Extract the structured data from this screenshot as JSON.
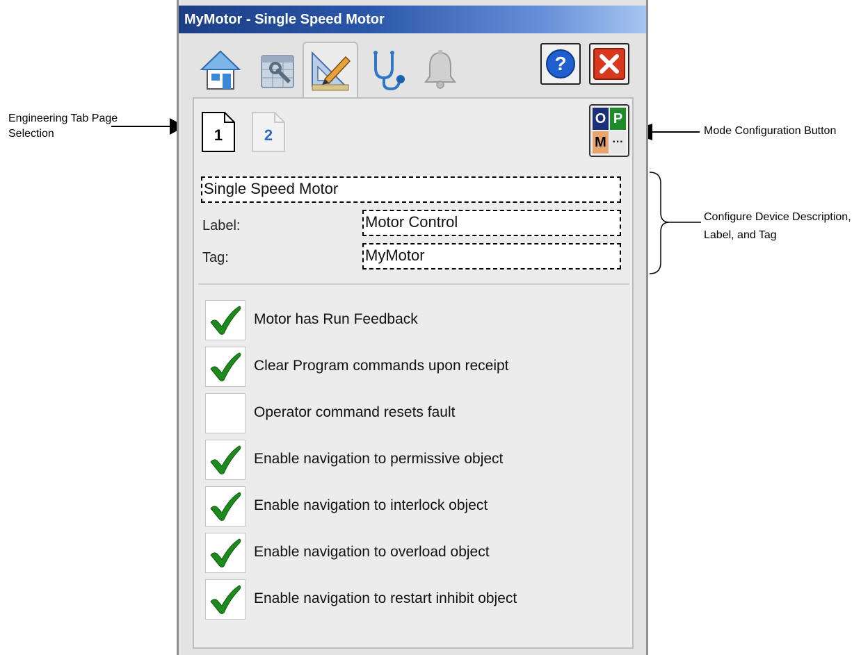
{
  "window": {
    "title": "MyMotor - Single Speed Motor"
  },
  "toolbar": {
    "tabs": [
      {
        "icon": "home-icon",
        "active": false
      },
      {
        "icon": "maintenance-icon",
        "active": false
      },
      {
        "icon": "engineering-icon",
        "active": true
      },
      {
        "icon": "diagnostics-icon",
        "active": false
      },
      {
        "icon": "alarm-bell-icon",
        "active": false
      }
    ],
    "help_label": "?",
    "close_label": "✕"
  },
  "pages": {
    "page1": "1",
    "page2": "2"
  },
  "mode_button": {
    "o": "O",
    "p": "P",
    "m": "M",
    "more": "···"
  },
  "description": {
    "value": "Single Speed Motor"
  },
  "label": {
    "caption": "Label:",
    "value": "Motor Control"
  },
  "tag": {
    "caption": "Tag:",
    "value": "MyMotor"
  },
  "options": [
    {
      "label": "Motor has Run Feedback",
      "checked": true
    },
    {
      "label": "Clear Program commands upon receipt",
      "checked": true
    },
    {
      "label": "Operator command resets fault",
      "checked": false
    },
    {
      "label": "Enable navigation to permissive object",
      "checked": true
    },
    {
      "label": "Enable navigation to interlock object",
      "checked": true
    },
    {
      "label": "Enable navigation to overload object",
      "checked": true
    },
    {
      "label": "Enable navigation to restart inhibit object",
      "checked": true
    }
  ],
  "annotations": {
    "engineering_tab": "Engineering Tab Page\nSelection",
    "engineering_tab_l1": "Engineering Tab Page",
    "engineering_tab_l2": "Selection",
    "mode_config": "Mode Configuration Button",
    "configure_l1": "Configure Device Description,",
    "configure_l2": "Label, and Tag"
  },
  "colors": {
    "check_green": "#1d8a1d",
    "title_start": "#1c3e85",
    "close_red": "#d8391e",
    "help_blue": "#1f5fcf"
  }
}
